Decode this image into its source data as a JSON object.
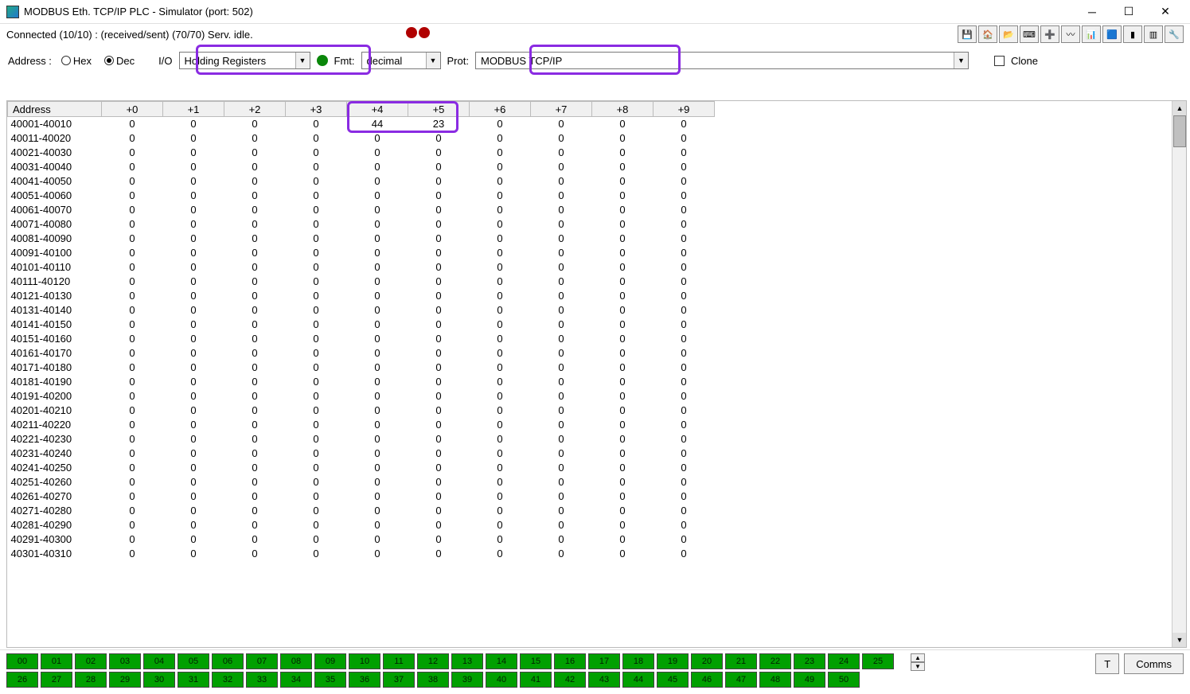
{
  "window": {
    "title": "MODBUS Eth. TCP/IP PLC - Simulator (port: 502)"
  },
  "status": {
    "text": "Connected (10/10) : (received/sent) (70/70) Serv. idle."
  },
  "toolbar_icons": [
    "save",
    "save-as",
    "open",
    "port",
    "add",
    "pulse",
    "graph",
    "rx",
    "fill",
    "columns",
    "filter"
  ],
  "controls": {
    "address_label": "Address :",
    "radio_hex": "Hex",
    "radio_dec": "Dec",
    "radio_selected": "Dec",
    "io_label": "I/O",
    "io_value": "Holding Registers",
    "fmt_label": "Fmt:",
    "fmt_value": "decimal",
    "prot_label": "Prot:",
    "prot_value": "MODBUS TCP/IP",
    "clone_label": "Clone"
  },
  "table": {
    "headers": [
      "Address",
      "+0",
      "+1",
      "+2",
      "+3",
      "+4",
      "+5",
      "+6",
      "+7",
      "+8",
      "+9"
    ],
    "rows": [
      {
        "addr": "40001-40010",
        "vals": [
          "0",
          "0",
          "0",
          "0",
          "44",
          "23",
          "0",
          "0",
          "0",
          "0"
        ]
      },
      {
        "addr": "40011-40020",
        "vals": [
          "0",
          "0",
          "0",
          "0",
          "0",
          "0",
          "0",
          "0",
          "0",
          "0"
        ]
      },
      {
        "addr": "40021-40030",
        "vals": [
          "0",
          "0",
          "0",
          "0",
          "0",
          "0",
          "0",
          "0",
          "0",
          "0"
        ]
      },
      {
        "addr": "40031-40040",
        "vals": [
          "0",
          "0",
          "0",
          "0",
          "0",
          "0",
          "0",
          "0",
          "0",
          "0"
        ]
      },
      {
        "addr": "40041-40050",
        "vals": [
          "0",
          "0",
          "0",
          "0",
          "0",
          "0",
          "0",
          "0",
          "0",
          "0"
        ]
      },
      {
        "addr": "40051-40060",
        "vals": [
          "0",
          "0",
          "0",
          "0",
          "0",
          "0",
          "0",
          "0",
          "0",
          "0"
        ]
      },
      {
        "addr": "40061-40070",
        "vals": [
          "0",
          "0",
          "0",
          "0",
          "0",
          "0",
          "0",
          "0",
          "0",
          "0"
        ]
      },
      {
        "addr": "40071-40080",
        "vals": [
          "0",
          "0",
          "0",
          "0",
          "0",
          "0",
          "0",
          "0",
          "0",
          "0"
        ]
      },
      {
        "addr": "40081-40090",
        "vals": [
          "0",
          "0",
          "0",
          "0",
          "0",
          "0",
          "0",
          "0",
          "0",
          "0"
        ]
      },
      {
        "addr": "40091-40100",
        "vals": [
          "0",
          "0",
          "0",
          "0",
          "0",
          "0",
          "0",
          "0",
          "0",
          "0"
        ]
      },
      {
        "addr": "40101-40110",
        "vals": [
          "0",
          "0",
          "0",
          "0",
          "0",
          "0",
          "0",
          "0",
          "0",
          "0"
        ]
      },
      {
        "addr": "40111-40120",
        "vals": [
          "0",
          "0",
          "0",
          "0",
          "0",
          "0",
          "0",
          "0",
          "0",
          "0"
        ]
      },
      {
        "addr": "40121-40130",
        "vals": [
          "0",
          "0",
          "0",
          "0",
          "0",
          "0",
          "0",
          "0",
          "0",
          "0"
        ]
      },
      {
        "addr": "40131-40140",
        "vals": [
          "0",
          "0",
          "0",
          "0",
          "0",
          "0",
          "0",
          "0",
          "0",
          "0"
        ]
      },
      {
        "addr": "40141-40150",
        "vals": [
          "0",
          "0",
          "0",
          "0",
          "0",
          "0",
          "0",
          "0",
          "0",
          "0"
        ]
      },
      {
        "addr": "40151-40160",
        "vals": [
          "0",
          "0",
          "0",
          "0",
          "0",
          "0",
          "0",
          "0",
          "0",
          "0"
        ]
      },
      {
        "addr": "40161-40170",
        "vals": [
          "0",
          "0",
          "0",
          "0",
          "0",
          "0",
          "0",
          "0",
          "0",
          "0"
        ]
      },
      {
        "addr": "40171-40180",
        "vals": [
          "0",
          "0",
          "0",
          "0",
          "0",
          "0",
          "0",
          "0",
          "0",
          "0"
        ]
      },
      {
        "addr": "40181-40190",
        "vals": [
          "0",
          "0",
          "0",
          "0",
          "0",
          "0",
          "0",
          "0",
          "0",
          "0"
        ]
      },
      {
        "addr": "40191-40200",
        "vals": [
          "0",
          "0",
          "0",
          "0",
          "0",
          "0",
          "0",
          "0",
          "0",
          "0"
        ]
      },
      {
        "addr": "40201-40210",
        "vals": [
          "0",
          "0",
          "0",
          "0",
          "0",
          "0",
          "0",
          "0",
          "0",
          "0"
        ]
      },
      {
        "addr": "40211-40220",
        "vals": [
          "0",
          "0",
          "0",
          "0",
          "0",
          "0",
          "0",
          "0",
          "0",
          "0"
        ]
      },
      {
        "addr": "40221-40230",
        "vals": [
          "0",
          "0",
          "0",
          "0",
          "0",
          "0",
          "0",
          "0",
          "0",
          "0"
        ]
      },
      {
        "addr": "40231-40240",
        "vals": [
          "0",
          "0",
          "0",
          "0",
          "0",
          "0",
          "0",
          "0",
          "0",
          "0"
        ]
      },
      {
        "addr": "40241-40250",
        "vals": [
          "0",
          "0",
          "0",
          "0",
          "0",
          "0",
          "0",
          "0",
          "0",
          "0"
        ]
      },
      {
        "addr": "40251-40260",
        "vals": [
          "0",
          "0",
          "0",
          "0",
          "0",
          "0",
          "0",
          "0",
          "0",
          "0"
        ]
      },
      {
        "addr": "40261-40270",
        "vals": [
          "0",
          "0",
          "0",
          "0",
          "0",
          "0",
          "0",
          "0",
          "0",
          "0"
        ]
      },
      {
        "addr": "40271-40280",
        "vals": [
          "0",
          "0",
          "0",
          "0",
          "0",
          "0",
          "0",
          "0",
          "0",
          "0"
        ]
      },
      {
        "addr": "40281-40290",
        "vals": [
          "0",
          "0",
          "0",
          "0",
          "0",
          "0",
          "0",
          "0",
          "0",
          "0"
        ]
      },
      {
        "addr": "40291-40300",
        "vals": [
          "0",
          "0",
          "0",
          "0",
          "0",
          "0",
          "0",
          "0",
          "0",
          "0"
        ]
      },
      {
        "addr": "40301-40310",
        "vals": [
          "0",
          "0",
          "0",
          "0",
          "0",
          "0",
          "0",
          "0",
          "0",
          "0"
        ]
      }
    ]
  },
  "footer": {
    "stations": [
      "00",
      "01",
      "02",
      "03",
      "04",
      "05",
      "06",
      "07",
      "08",
      "09",
      "10",
      "11",
      "12",
      "13",
      "14",
      "15",
      "16",
      "17",
      "18",
      "19",
      "20",
      "21",
      "22",
      "23",
      "24",
      "25",
      "26",
      "27",
      "28",
      "29",
      "30",
      "31",
      "32",
      "33",
      "34",
      "35",
      "36",
      "37",
      "38",
      "39",
      "40",
      "41",
      "42",
      "43",
      "44",
      "45",
      "46",
      "47",
      "48",
      "49",
      "50"
    ],
    "t_button": "T",
    "comms_button": "Comms"
  }
}
